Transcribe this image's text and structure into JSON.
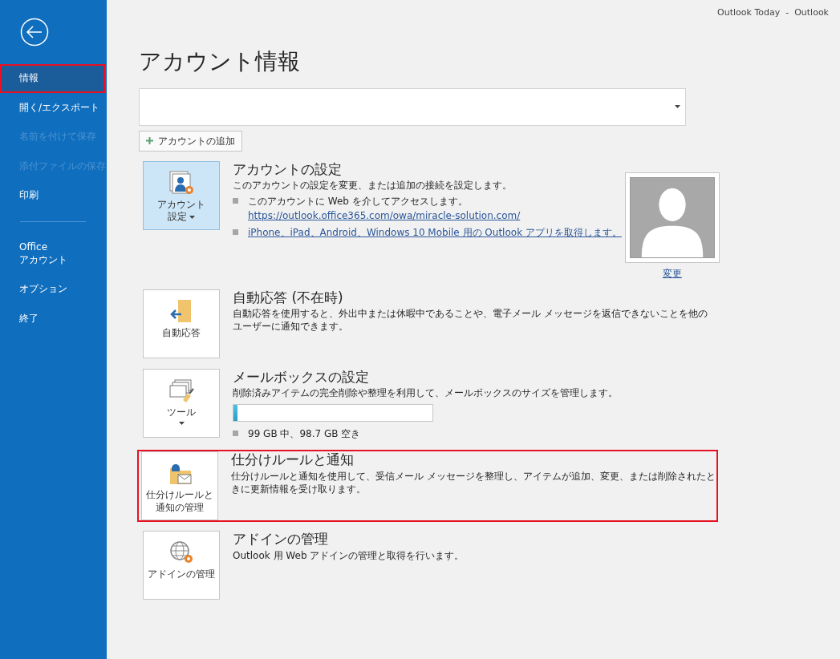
{
  "window": {
    "title": "Outlook Today  -  Outlook"
  },
  "sidebar": {
    "items": [
      {
        "label": "情報",
        "selected": true,
        "disabled": false,
        "highlighted": true
      },
      {
        "label": "開く/エクスポート",
        "selected": false,
        "disabled": false,
        "highlighted": false
      },
      {
        "label": "名前を付けて保存",
        "selected": false,
        "disabled": true,
        "highlighted": false
      },
      {
        "label": "添付ファイルの保存",
        "selected": false,
        "disabled": true,
        "highlighted": false
      },
      {
        "label": "印刷",
        "selected": false,
        "disabled": false,
        "highlighted": false,
        "divider_after": true
      },
      {
        "label": "Office\nアカウント",
        "selected": false,
        "disabled": false,
        "highlighted": false
      },
      {
        "label": "オプション",
        "selected": false,
        "disabled": false,
        "highlighted": false
      },
      {
        "label": "終了",
        "selected": false,
        "disabled": false,
        "highlighted": false
      }
    ]
  },
  "page_title": "アカウント情報",
  "add_account_button": "アカウントの追加",
  "sections": [
    {
      "kind": "account",
      "button_label": [
        "アカウント",
        "設定"
      ],
      "dropdown": true,
      "selected": true,
      "highlighted": false,
      "title": "アカウントの設定",
      "description": "このアカウントの設定を変更、または追加の接続を設定します。",
      "bullets": [
        {
          "text": "このアカウントに Web を介してアクセスします。",
          "link": "https://outlook.office365.com/owa/miracle-solution.com/"
        },
        {
          "link": "iPhone、iPad、Android、Windows 10 Mobile 用の Outlook アプリを取得します。"
        }
      ],
      "photo": {
        "change_link": "変更"
      }
    },
    {
      "kind": "auto_reply",
      "button_label": [
        "自動応答"
      ],
      "dropdown": false,
      "selected": false,
      "highlighted": false,
      "title": "自動応答 (不在時)",
      "description": "自動応答を使用すると、外出中または休暇中であることや、電子メール メッセージを返信できないことを他のユーザーに通知できます。"
    },
    {
      "kind": "mailbox",
      "button_label": [
        "ツール"
      ],
      "dropdown": true,
      "selected": false,
      "highlighted": false,
      "title": "メールボックスの設定",
      "description": "削除済みアイテムの完全削除や整理を利用して、メールボックスのサイズを管理します。",
      "usage": {
        "level": 0.02,
        "reading": "99 GB 中、98.7 GB 空き"
      }
    },
    {
      "kind": "rules",
      "button_label": [
        "仕分けルールと",
        "通知の管理"
      ],
      "dropdown": false,
      "selected": false,
      "highlighted": true,
      "title": "仕分けルールと通知",
      "description": "仕分けルールと通知を使用して、受信メール メッセージを整理し、アイテムが追加、変更、または削除されたときに更新情報を受け取ります。"
    },
    {
      "kind": "addins",
      "button_label": [
        "アドインの管理"
      ],
      "dropdown": false,
      "selected": false,
      "highlighted": false,
      "title": "アドインの管理",
      "description": "Outlook 用 Web アドインの管理と取得を行います。"
    }
  ]
}
